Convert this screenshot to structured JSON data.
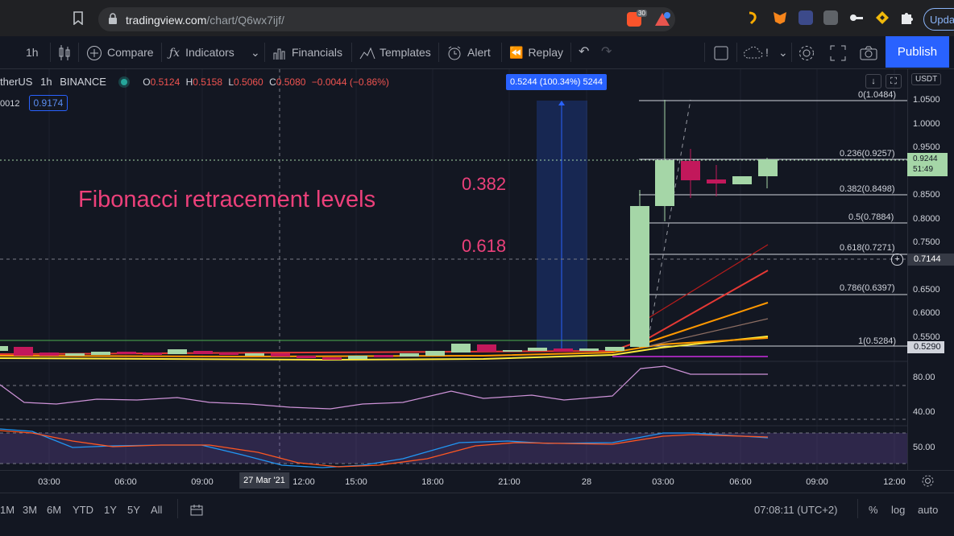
{
  "browser": {
    "url_host": "tradingview.com",
    "url_path": "/chart/Q6wx7ijf/",
    "brave_badge": "30",
    "update_label": "Update"
  },
  "toolbar": {
    "interval": "1h",
    "compare": "Compare",
    "indicators": "Indicators",
    "financials": "Financials",
    "templates": "Templates",
    "alert": "Alert",
    "replay": "Replay",
    "drawing_hint": "!",
    "publish": "Publish"
  },
  "legend": {
    "symbol": "therUS",
    "interval": "1h",
    "exchange": "BINANCE",
    "open_label": "O",
    "open": "0.5124",
    "high_label": "H",
    "high": "0.5158",
    "low_label": "L",
    "low": "0.5060",
    "close_label": "C",
    "close": "0.5080",
    "change": "−0.0044 (−0.86%)",
    "indicator_value_left": "0012",
    "indicator_value_box": "0.9174"
  },
  "measure_label": "0.5244 (100.34%) 5244",
  "annotations": {
    "title": "Fibonacci retracement levels",
    "lvl382": "0.382",
    "lvl618": "0.618"
  },
  "fib_labels": {
    "f0": "0(1.0484)",
    "f236": "0.236(0.9257)",
    "f382": "0.382(0.8498)",
    "f5": "0.5(0.7884)",
    "f618": "0.618(0.7271)",
    "f786": "0.786(0.6397)",
    "f1": "1(0.5284)"
  },
  "price_axis": {
    "currency": "USDT",
    "ticks": [
      "1.0500",
      "1.0000",
      "0.9500",
      "0.8500",
      "0.8000",
      "0.7500",
      "0.6500",
      "0.6000",
      "0.5500"
    ],
    "current_price": "0.9244",
    "countdown": "51:49",
    "crosshair_price": "0.7144",
    "last_marker": "0.5290",
    "rsi_ticks": [
      "80.00",
      "40.00"
    ],
    "stoch_ticks": [
      "50.00"
    ]
  },
  "time_axis": {
    "ticks": [
      "03:00",
      "06:00",
      "09:00",
      "27 Mar '21",
      "12:00",
      "15:00",
      "18:00",
      "21:00",
      "28",
      "03:00",
      "06:00",
      "09:00",
      "12:00"
    ]
  },
  "bottom_bar": {
    "ranges": [
      "1M",
      "3M",
      "6M",
      "YTD",
      "1Y",
      "5Y",
      "All"
    ],
    "clock": "07:08:11 (UTC+2)",
    "percent": "%",
    "log": "log",
    "auto": "auto"
  },
  "colors": {
    "bg": "#131722",
    "up": "#a5d6a7",
    "down": "#c2185b",
    "accent": "#2962ff",
    "annotation": "#ec407a"
  }
}
